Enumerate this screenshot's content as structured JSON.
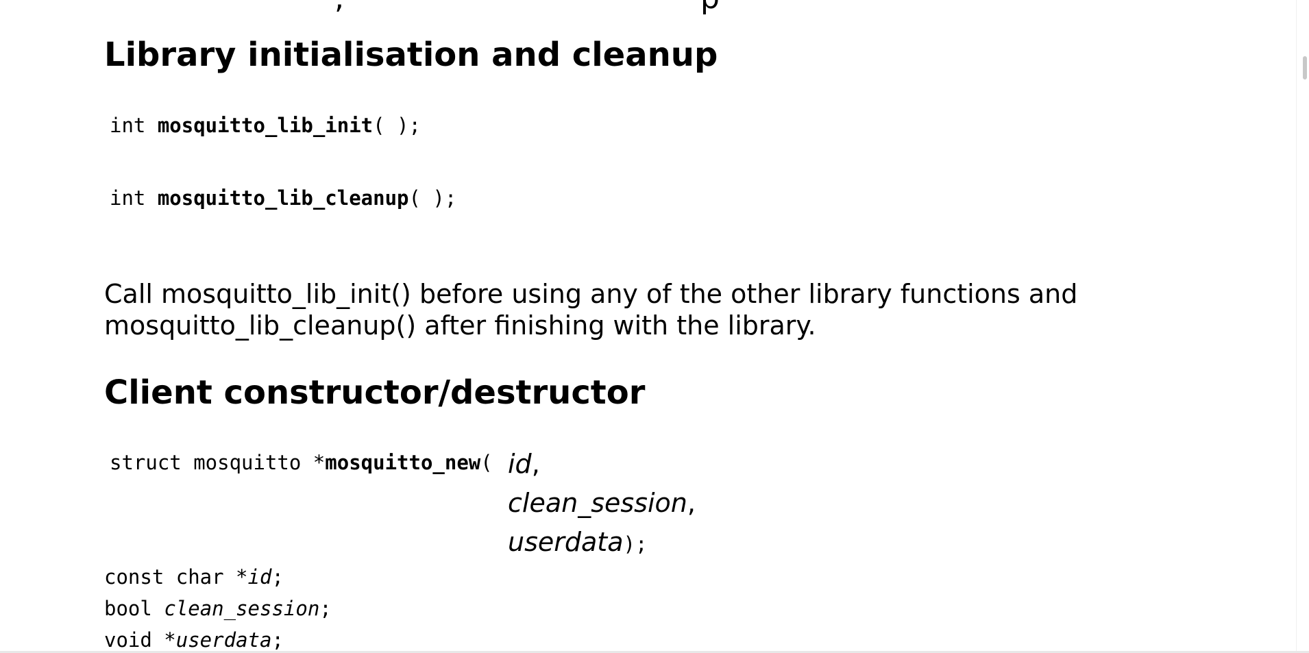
{
  "top_fragment": {
    "left": ",",
    "right": "p"
  },
  "section1": {
    "heading": "Library initialisation and cleanup",
    "sig1": {
      "ret": "int ",
      "name": "mosquitto_lib_init",
      "args": "( );"
    },
    "sig2": {
      "ret": "int ",
      "name": "mosquitto_lib_cleanup",
      "args": "( );"
    },
    "para_line1": "Call mosquitto_lib_init() before using any of the other library functions and",
    "para_line2": "mosquitto_lib_cleanup() after finishing with the library."
  },
  "section2": {
    "heading": "Client constructor/destructor",
    "sig": {
      "ret": "struct mosquitto *",
      "name": "mosquitto_new",
      "open": "( ",
      "p1": "id",
      "sep1": ",",
      "p2": "clean_session",
      "sep2": ",",
      "p3": "userdata",
      "close": ");"
    },
    "decls": [
      {
        "type": "const char *",
        "name": "id",
        "end": ";"
      },
      {
        "type": "bool ",
        "name": "clean_session",
        "end": ";"
      },
      {
        "type": "void *",
        "name": "userdata",
        "end": ";"
      }
    ]
  }
}
